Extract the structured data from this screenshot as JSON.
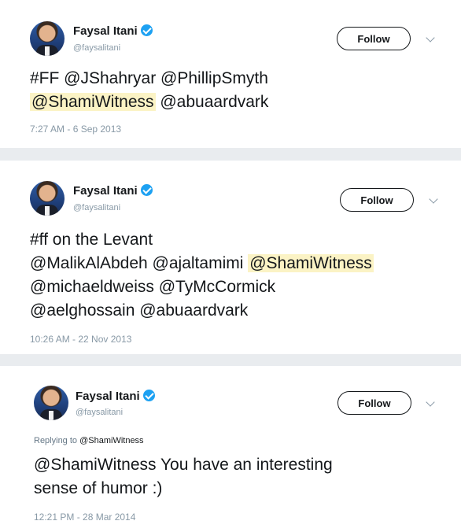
{
  "tweets": [
    {
      "name": "Faysal Itani",
      "handle": "@faysalitani",
      "follow_label": "Follow",
      "lines": [
        [
          "#FF @JShahryar @PhillipSmyth"
        ],
        [
          "@ShamiWitness",
          " @abuaardvark"
        ]
      ],
      "timestamp": "7:27 AM - 6 Sep 2013"
    },
    {
      "name": "Faysal Itani",
      "handle": "@faysalitani",
      "follow_label": "Follow",
      "lines": [
        [
          "#ff on the Levant"
        ],
        [
          "@MalikAlAbdeh @ajaltamimi ",
          "@ShamiWitness"
        ],
        [
          "@michaeldweiss @TyMcCormick"
        ],
        [
          "@aelghossain @abuaardvark"
        ]
      ],
      "timestamp": "10:26 AM - 22 Nov 2013"
    },
    {
      "name": "Faysal Itani",
      "handle": "@faysalitani",
      "follow_label": "Follow",
      "replying_prefix": "Replying to ",
      "replying_handle": "@ShamiWitness",
      "lines": [
        [
          "@ShamiWitness You have an interesting"
        ],
        [
          "sense of humor :)"
        ]
      ],
      "timestamp": "12:21 PM - 28 Mar 2014"
    }
  ],
  "colors": {
    "highlight": "#fbf3c5",
    "verified": "#1da1f2",
    "muted": "#8899a6"
  },
  "icons": [
    "verified-badge-icon",
    "chevron-down-icon"
  ]
}
